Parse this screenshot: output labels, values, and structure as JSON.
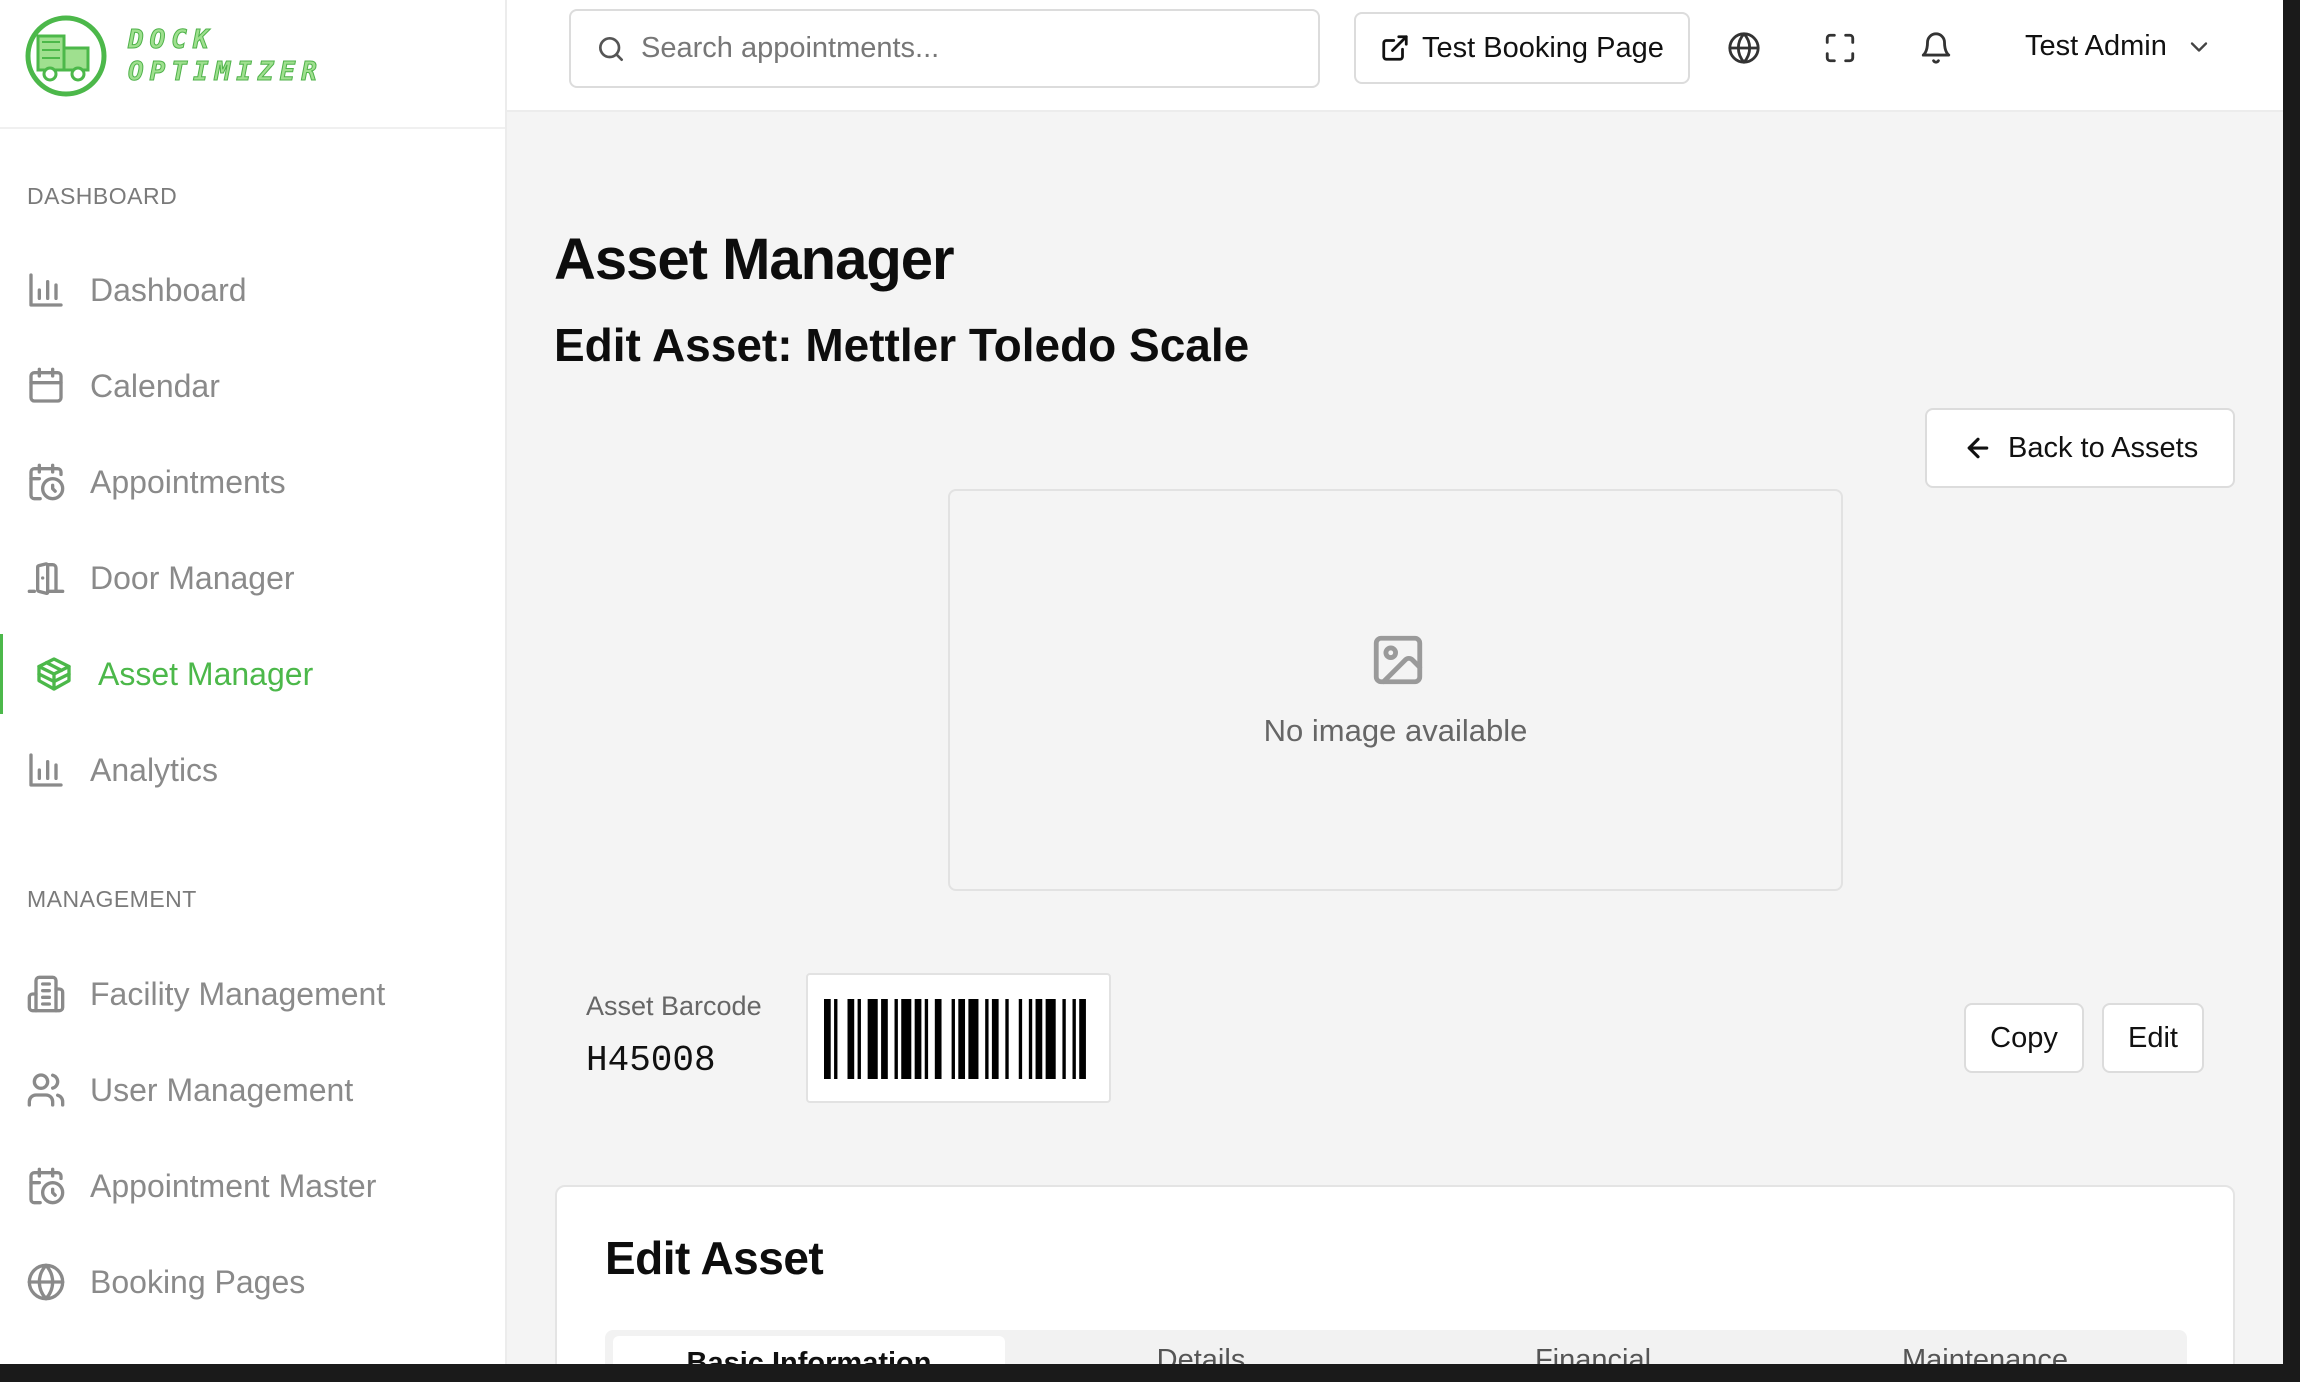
{
  "brand": {
    "line1": "DOCK",
    "line2": "OPTIMIZER",
    "accent_color": "#4cb84a"
  },
  "sidebar": {
    "sections": [
      {
        "title": "DASHBOARD"
      },
      {
        "title": "MANAGEMENT"
      }
    ],
    "items": [
      {
        "label": "Dashboard",
        "icon": "bar-chart-icon"
      },
      {
        "label": "Calendar",
        "icon": "calendar-icon"
      },
      {
        "label": "Appointments",
        "icon": "calendar-clock-icon"
      },
      {
        "label": "Door Manager",
        "icon": "door-icon"
      },
      {
        "label": "Asset Manager",
        "icon": "package-icon",
        "active": true
      },
      {
        "label": "Analytics",
        "icon": "bar-chart-icon"
      },
      {
        "label": "Facility Management",
        "icon": "building-icon"
      },
      {
        "label": "User Management",
        "icon": "users-icon"
      },
      {
        "label": "Appointment Master",
        "icon": "calendar-clock-icon"
      },
      {
        "label": "Booking Pages",
        "icon": "globe-icon"
      }
    ]
  },
  "header": {
    "search_placeholder": "Search appointments...",
    "booking_button": "Test Booking Page",
    "user_name": "Test Admin"
  },
  "main": {
    "title": "Asset Manager",
    "subtitle": "Edit Asset: Mettler Toledo Scale",
    "back_button": "Back to Assets",
    "image_placeholder": "No image available",
    "barcode": {
      "label": "Asset Barcode",
      "value": "H45008"
    },
    "copy_button": "Copy",
    "edit_button": "Edit",
    "edit_card": {
      "title": "Edit Asset",
      "tabs": [
        "Basic Information",
        "Details",
        "Financial",
        "Maintenance"
      ],
      "active_tab": 0
    }
  }
}
